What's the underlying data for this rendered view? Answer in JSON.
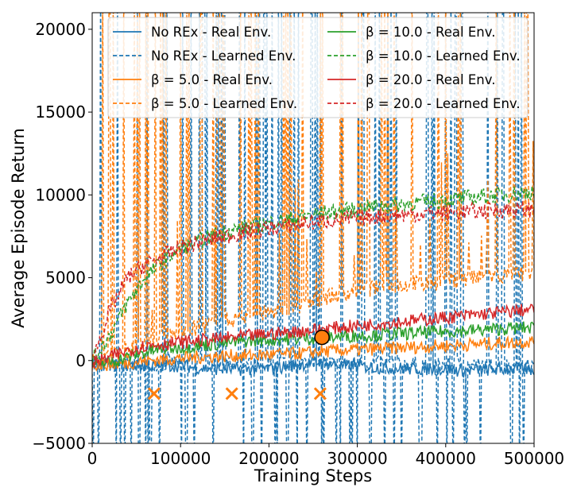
{
  "chart_data": {
    "type": "line",
    "xlabel": "Training Steps",
    "ylabel": "Average Episode Return",
    "xlim": [
      0,
      500000
    ],
    "ylim": [
      -5000,
      21000
    ],
    "x_ticks": [
      0,
      100000,
      200000,
      300000,
      400000,
      500000
    ],
    "y_ticks": [
      -5000,
      0,
      5000,
      10000,
      15000,
      20000
    ],
    "x_tick_labels": [
      "0",
      "100000",
      "200000",
      "300000",
      "400000",
      "500000"
    ],
    "y_tick_labels": [
      "−5000",
      "0",
      "5000",
      "10000",
      "15000",
      "20000"
    ],
    "grid": false,
    "legend_position": "top",
    "x": [
      0,
      20000,
      40000,
      60000,
      80000,
      100000,
      120000,
      140000,
      160000,
      180000,
      200000,
      220000,
      240000,
      260000,
      280000,
      300000,
      320000,
      340000,
      360000,
      380000,
      400000,
      420000,
      440000,
      460000,
      480000,
      500000
    ],
    "series": [
      {
        "name": "No REx - Real Env.",
        "color": "#1f77b4",
        "dash": "solid",
        "env": "real",
        "values": [
          -200,
          -300,
          -300,
          -350,
          -300,
          -300,
          -450,
          -500,
          -550,
          -500,
          -500,
          -350,
          -200,
          -100,
          -300,
          -350,
          -400,
          -450,
          -500,
          -500,
          -550,
          -600,
          -550,
          -550,
          -500,
          -550
        ]
      },
      {
        "name": "No REx - Learned Env.",
        "color": "#1f77b4",
        "dash": "dashed",
        "env": "learned",
        "spiky": true,
        "values": [
          -300,
          -250,
          -200,
          -200,
          -150,
          -150,
          -200,
          -200,
          -250,
          -250,
          -200,
          -200,
          -150,
          -150,
          -200,
          -200,
          -200,
          -250,
          -250,
          -250,
          -300,
          -300,
          -300,
          -300,
          -350,
          -350
        ]
      },
      {
        "name": "β = 5.0 - Real Env.",
        "color": "#ff7f0e",
        "dash": "solid",
        "env": "real",
        "values": [
          -200,
          -250,
          -150,
          0,
          50,
          150,
          200,
          250,
          300,
          300,
          350,
          400,
          450,
          550,
          600,
          650,
          700,
          750,
          800,
          850,
          900,
          950,
          1000,
          1050,
          1100,
          1150
        ]
      },
      {
        "name": "β = 5.0 - Learned Env.",
        "color": "#ff7f0e",
        "dash": "dashed",
        "env": "learned",
        "spiky": true,
        "values": [
          -100,
          200,
          600,
          1000,
          1400,
          1700,
          2000,
          2300,
          2500,
          2700,
          2900,
          3100,
          3300,
          3800,
          4000,
          4200,
          4400,
          4500,
          4600,
          4700,
          4800,
          4900,
          5000,
          5100,
          5200,
          5300
        ]
      },
      {
        "name": "β = 10.0 - Real Env.",
        "color": "#2ca02c",
        "dash": "solid",
        "env": "real",
        "values": [
          -200,
          -100,
          200,
          500,
          700,
          800,
          900,
          1000,
          1100,
          1200,
          1250,
          1300,
          1350,
          1400,
          1450,
          1500,
          1550,
          1600,
          1650,
          1700,
          1750,
          1800,
          1850,
          1900,
          1950,
          2000
        ]
      },
      {
        "name": "β = 10.0 - Learned Env.",
        "color": "#2ca02c",
        "dash": "dashed",
        "env": "learned",
        "values": [
          0,
          1500,
          3500,
          5000,
          6000,
          6800,
          7200,
          7600,
          7900,
          8100,
          8300,
          8500,
          8700,
          8900,
          9000,
          9100,
          9300,
          9400,
          9500,
          9600,
          9700,
          9800,
          9900,
          10000,
          10100,
          10200
        ]
      },
      {
        "name": "β = 20.0 - Real Env.",
        "color": "#d62728",
        "dash": "solid",
        "env": "real",
        "values": [
          -200,
          200,
          600,
          900,
          1000,
          1100,
          1200,
          1300,
          1400,
          1500,
          1600,
          1700,
          1800,
          1900,
          2000,
          2100,
          2200,
          2300,
          2400,
          2500,
          2600,
          2700,
          2800,
          2900,
          3000,
          3100
        ]
      },
      {
        "name": "β = 20.0 - Learned Env.",
        "color": "#d62728",
        "dash": "dashed",
        "env": "learned",
        "values": [
          0,
          3000,
          5000,
          5800,
          6300,
          6800,
          7100,
          7400,
          7600,
          7800,
          8000,
          8100,
          8300,
          8400,
          8500,
          8600,
          8700,
          8800,
          8800,
          8900,
          8900,
          9000,
          9000,
          9100,
          9100,
          9100
        ]
      }
    ],
    "markers": [
      {
        "type": "x",
        "color": "#ff7f0e",
        "x": 70000,
        "y": -2000
      },
      {
        "type": "x",
        "color": "#ff7f0e",
        "x": 158000,
        "y": -2000
      },
      {
        "type": "x",
        "color": "#ff7f0e",
        "x": 258000,
        "y": -2000
      },
      {
        "type": "circle",
        "color": "#ff7f0e",
        "x": 260000,
        "y": 1400
      }
    ]
  }
}
